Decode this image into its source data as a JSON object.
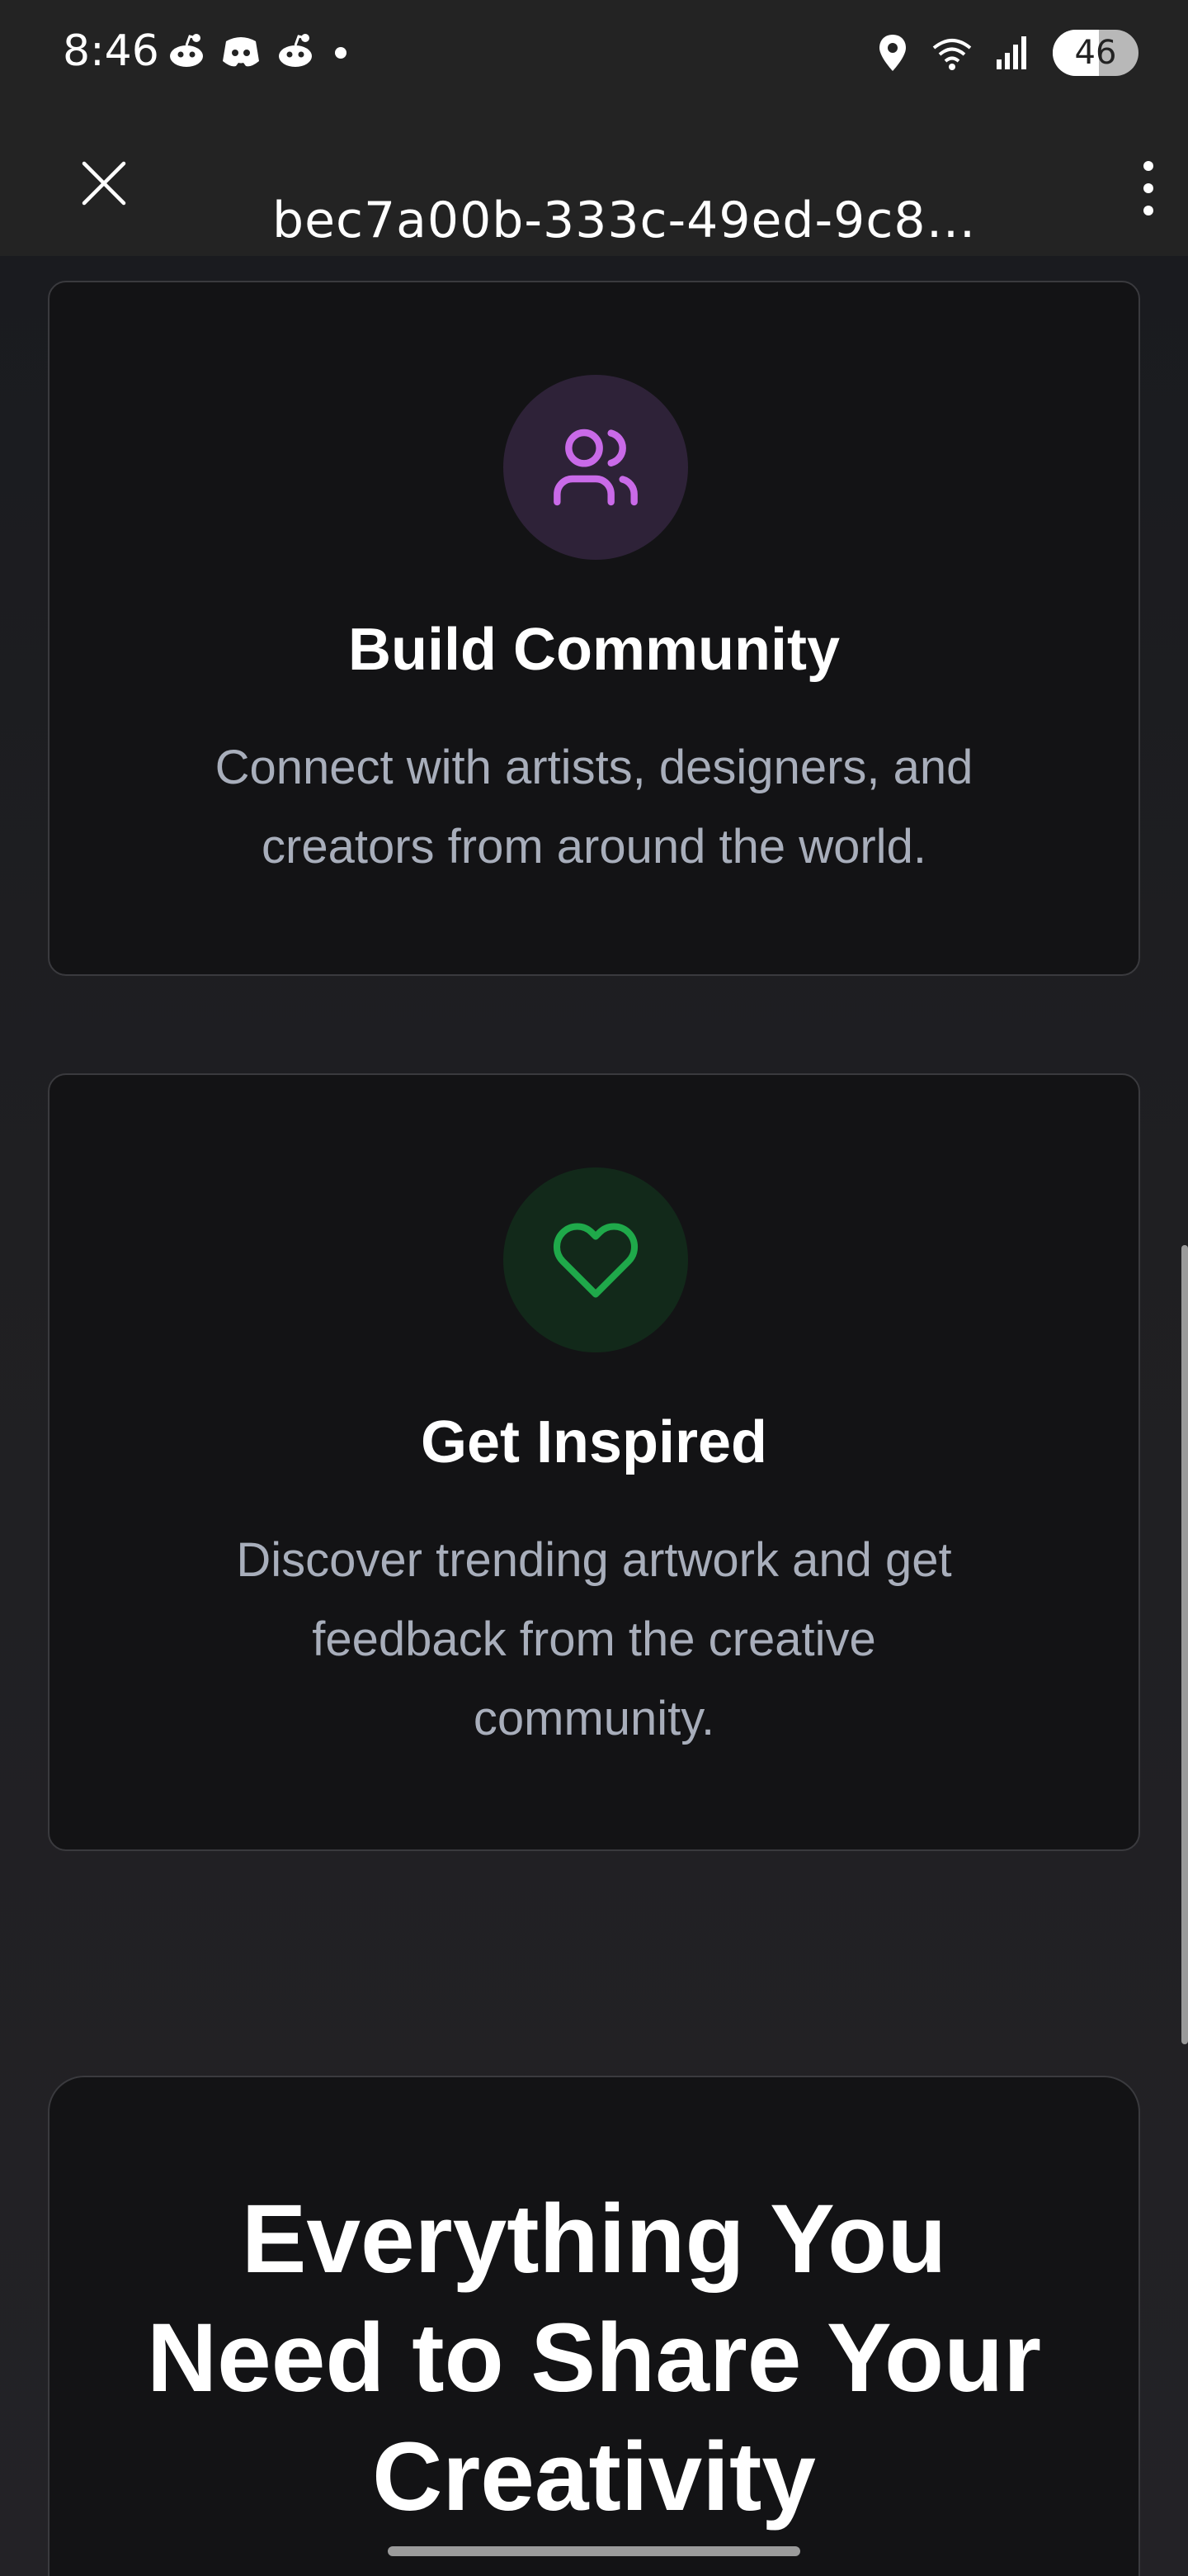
{
  "status_bar": {
    "time": "8:46",
    "battery": "46",
    "left_icons": [
      "reddit-icon",
      "discord-icon",
      "reddit-icon",
      "dot-icon"
    ],
    "right_icons": [
      "location-icon",
      "wifi-icon",
      "signal-icon",
      "battery-icon"
    ]
  },
  "browser": {
    "url": "bec7a00b-333c-49ed-9c8…",
    "close_icon": "close-icon",
    "menu_icon": "more-vertical-icon"
  },
  "features": [
    {
      "icon": "users-icon",
      "title": "Build Community",
      "description_line1": "Connect with artists, designers, and",
      "description_line2": "creators from around the world.",
      "icon_color": "#c96ae8",
      "icon_bg": "#2e2238"
    },
    {
      "icon": "heart-icon",
      "title": "Get Inspired",
      "description_line1": "Discover trending artwork and get",
      "description_line2": "feedback from the creative",
      "description_line3": "community.",
      "icon_color": "#1fa94a",
      "icon_bg": "#12291a"
    }
  ],
  "section": {
    "heading_line1": "Everything You",
    "heading_line2": "Need to Share Your",
    "heading_line3": "Creativity"
  },
  "colors": {
    "background": "#1c1c1f",
    "card": "#131315",
    "card_border": "#3a3a3e",
    "muted_text": "#a8aebb"
  }
}
